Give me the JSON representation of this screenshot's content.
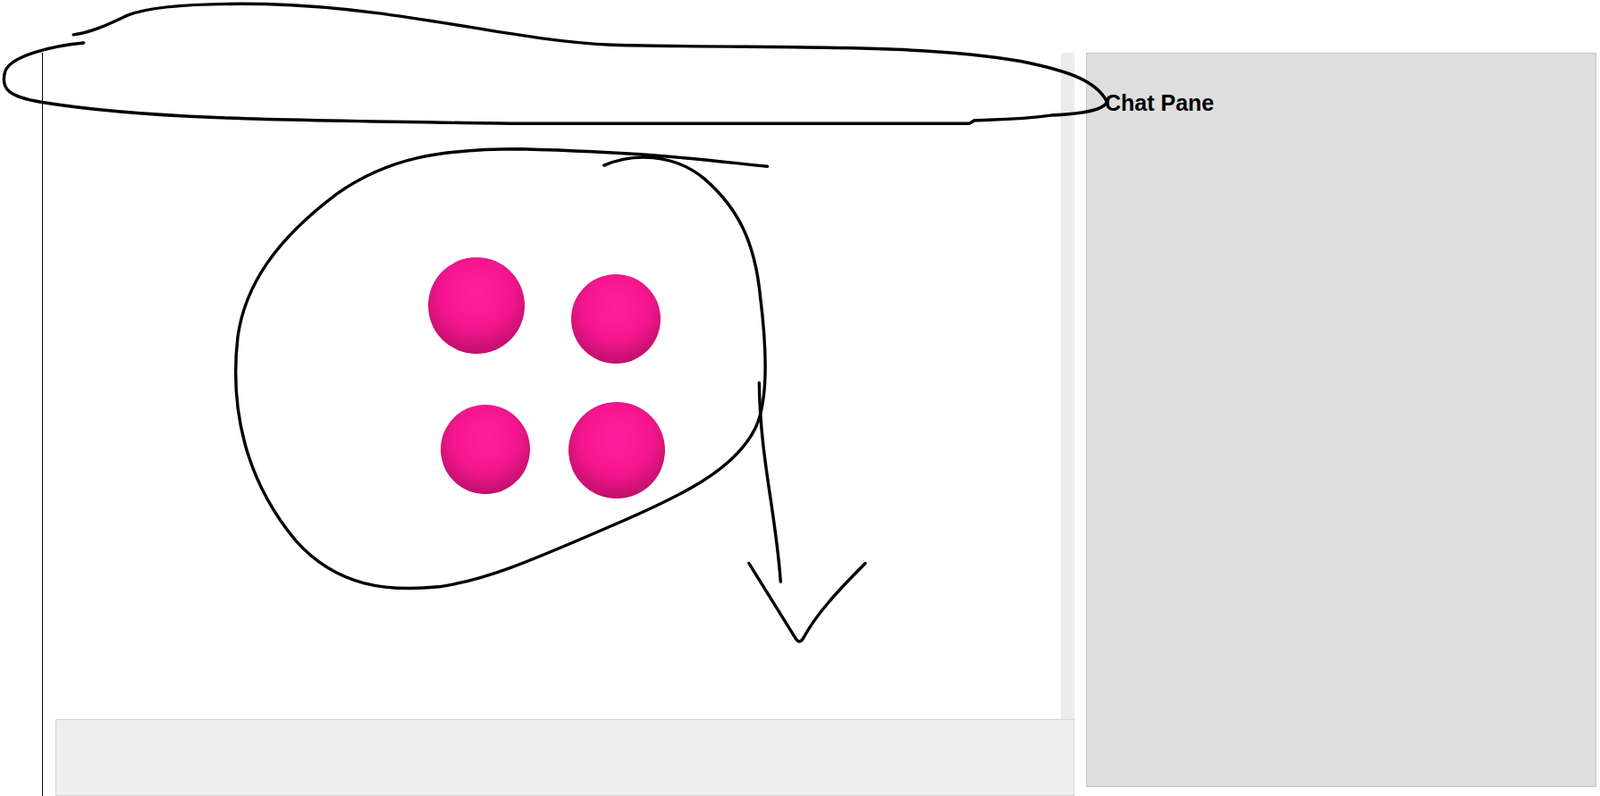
{
  "chat_pane": {
    "title": "Chat Pane"
  },
  "canvas": {
    "balls": [
      {
        "kind": "sphere"
      },
      {
        "kind": "sphere"
      },
      {
        "kind": "sphere"
      },
      {
        "kind": "sphere"
      }
    ]
  }
}
